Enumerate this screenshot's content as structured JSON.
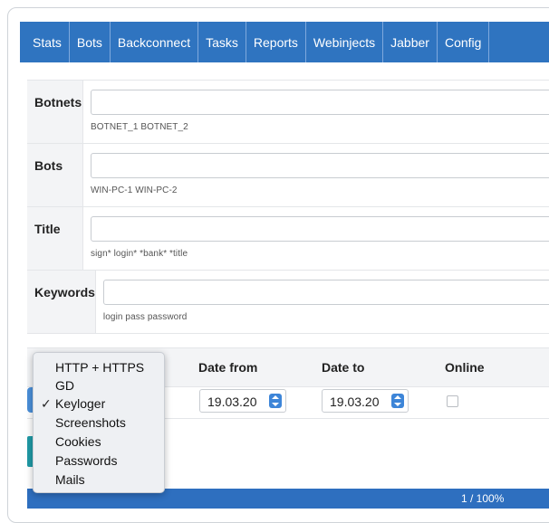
{
  "nav": {
    "items": [
      "Stats",
      "Bots",
      "Backconnect",
      "Tasks",
      "Reports",
      "Webinjects",
      "Jabber",
      "Config",
      ""
    ]
  },
  "filters": [
    {
      "label": "Botnets",
      "hint": "BOTNET_1 BOTNET_2",
      "value": ""
    },
    {
      "label": "Bots",
      "hint": "WIN-PC-1 WIN-PC-2",
      "value": ""
    },
    {
      "label": "Title",
      "hint": "sign* login* *bank* *title",
      "value": ""
    },
    {
      "label": "Keywords",
      "hint": "login pass password",
      "value": ""
    }
  ],
  "options": {
    "headers": {
      "date_from": "Date from",
      "date_to": "Date to",
      "online": "Online"
    },
    "date_from_value": "19.03.20",
    "date_to_value": "19.03.20",
    "online_checked": false
  },
  "type_dropdown": {
    "options": [
      "HTTP + HTTPS",
      "GD",
      "Keyloger",
      "Screenshots",
      "Cookies",
      "Passwords",
      "Mails"
    ],
    "selected": "Keyloger",
    "check_glyph": "✓"
  },
  "progress": {
    "text": "1 / 100%",
    "color": "#2e6fbf"
  },
  "colors": {
    "navbar": "#2f74c0",
    "accent": "#3d85d8",
    "teal": "#1f9aa6"
  }
}
